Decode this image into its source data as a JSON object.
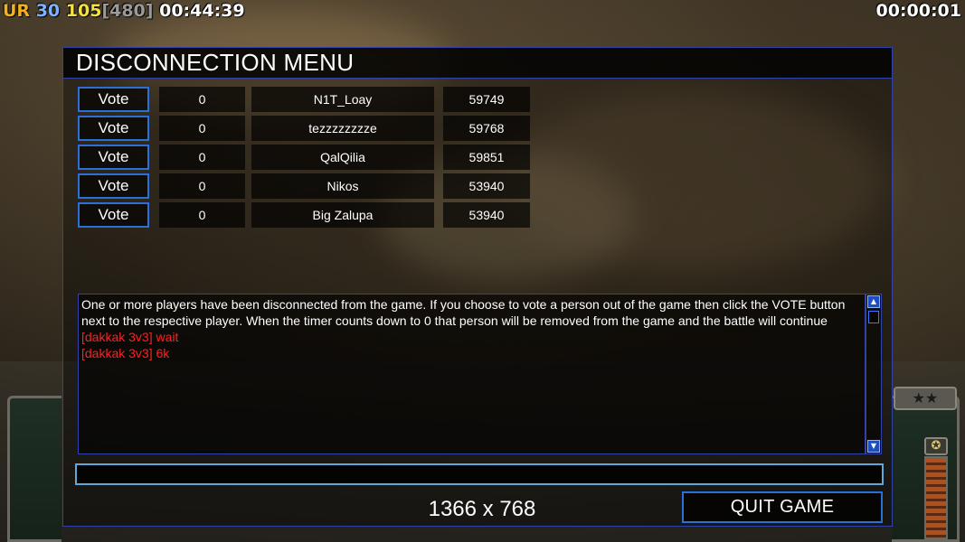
{
  "hud": {
    "prefix": "UR",
    "fps": "30",
    "logic": "105",
    "logic_bracket": "[480]",
    "game_time": "00:44:39",
    "countdown": "00:00:01",
    "prefix_color": "#f2b01e",
    "fps_color": "#7fb3ff",
    "logic_color": "#f5e23c",
    "bracket_color": "#9a9a9a"
  },
  "menu": {
    "title": "DISCONNECTION MENU",
    "vote_label": "Vote",
    "players": [
      {
        "votes": "0",
        "name": "N1T_Loay",
        "ping": "59749"
      },
      {
        "votes": "0",
        "name": "tezzzzzzzze",
        "ping": "59768"
      },
      {
        "votes": "0",
        "name": "QalQilia",
        "ping": "59851"
      },
      {
        "votes": "0",
        "name": "Nikos",
        "ping": "53940"
      },
      {
        "votes": "0",
        "name": "Big Zalupa",
        "ping": "53940"
      }
    ],
    "chat": {
      "system_message": "One or more players have been disconnected from the game. If you choose to vote a person out of the game then click the VOTE button next to the respective player. When the timer counts down to 0 that person will be removed from the game and the battle will continue",
      "messages": [
        "[dakkak 3v3] wait",
        "[dakkak 3v3] 6k"
      ],
      "message_color": "#ff2020"
    },
    "chat_input_value": "",
    "resolution": "1366 x 768",
    "quit_label": "QUIT GAME",
    "accent_color": "#2b70d8"
  }
}
